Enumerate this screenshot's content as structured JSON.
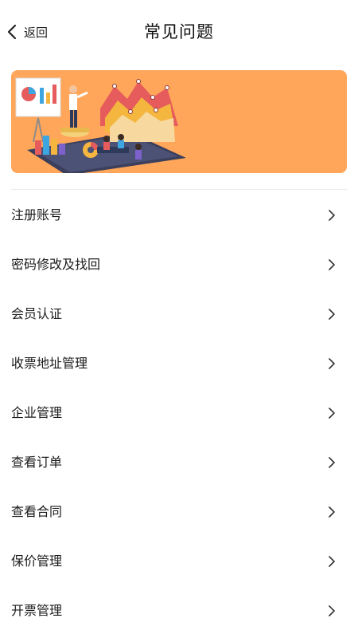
{
  "header": {
    "back_label": "返回",
    "title": "常见问题"
  },
  "banner": {
    "background_color": "#ffa65a",
    "image": "business-analytics-illustration"
  },
  "faq_items": [
    {
      "label": "注册账号"
    },
    {
      "label": "密码修改及找回"
    },
    {
      "label": "会员认证"
    },
    {
      "label": "收票地址管理"
    },
    {
      "label": "企业管理"
    },
    {
      "label": "查看订单"
    },
    {
      "label": "查看合同"
    },
    {
      "label": "保价管理"
    },
    {
      "label": "开票管理"
    }
  ]
}
